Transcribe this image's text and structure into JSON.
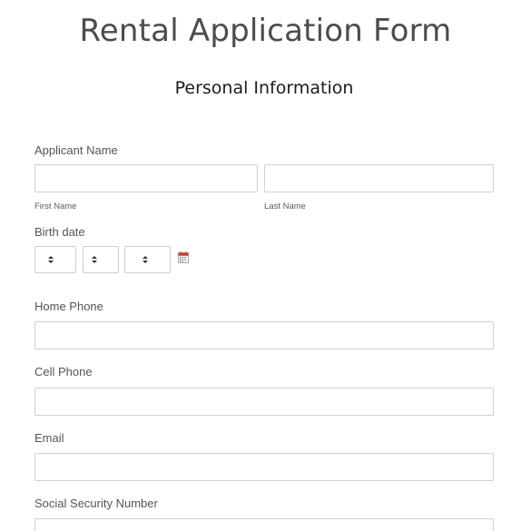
{
  "form": {
    "title": "Rental Application Form",
    "section_title": "Personal Information"
  },
  "applicant_name": {
    "label": "Applicant Name",
    "first_name_sublabel": "First Name",
    "last_name_sublabel": "Last Name",
    "first_name_value": "",
    "last_name_value": ""
  },
  "birth_date": {
    "label": "Birth date",
    "month_value": "",
    "day_value": "",
    "year_value": "",
    "calendar_icon": "calendar-icon"
  },
  "home_phone": {
    "label": "Home Phone",
    "value": ""
  },
  "cell_phone": {
    "label": "Cell Phone",
    "value": ""
  },
  "email": {
    "label": "Email",
    "value": ""
  },
  "ssn": {
    "label": "Social Security Number",
    "value": ""
  },
  "colors": {
    "title": "#4b4b50",
    "label": "#555555",
    "input_border": "#cfcfcf",
    "calendar_red": "#c0392b"
  }
}
